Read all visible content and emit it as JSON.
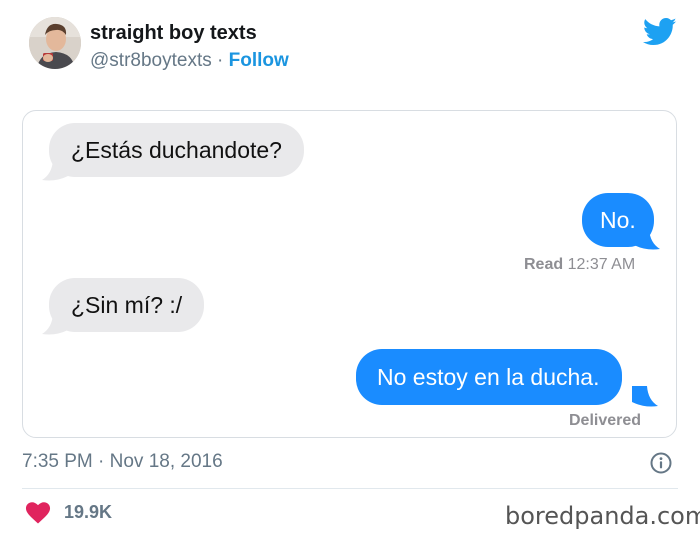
{
  "author": {
    "display_name": "straight boy texts",
    "handle": "@str8boytexts",
    "separator": " · ",
    "follow_label": "Follow"
  },
  "conversation": {
    "messages": [
      {
        "direction": "incoming",
        "text": "¿Estás duchandote?"
      },
      {
        "direction": "outgoing",
        "text": "No."
      },
      {
        "direction": "incoming",
        "text": "¿Sin mí? :/"
      },
      {
        "direction": "outgoing",
        "text": "No estoy en la ducha."
      }
    ],
    "read_label": "Read",
    "read_time": " 12:37 AM",
    "delivered_label": "Delivered"
  },
  "footer": {
    "timestamp": "7:35 PM · Nov 18, 2016",
    "likes": "19.9K"
  },
  "watermark": "boredpanda.com",
  "colors": {
    "twitter_blue": "#1da1f2",
    "link_blue": "#1b95e0",
    "imessage_blue": "#1a8cff",
    "incoming_gray": "#e9e9eb",
    "heart_pink": "#e0245e"
  },
  "icons": [
    "twitter-bird-icon",
    "info-icon",
    "heart-icon"
  ]
}
